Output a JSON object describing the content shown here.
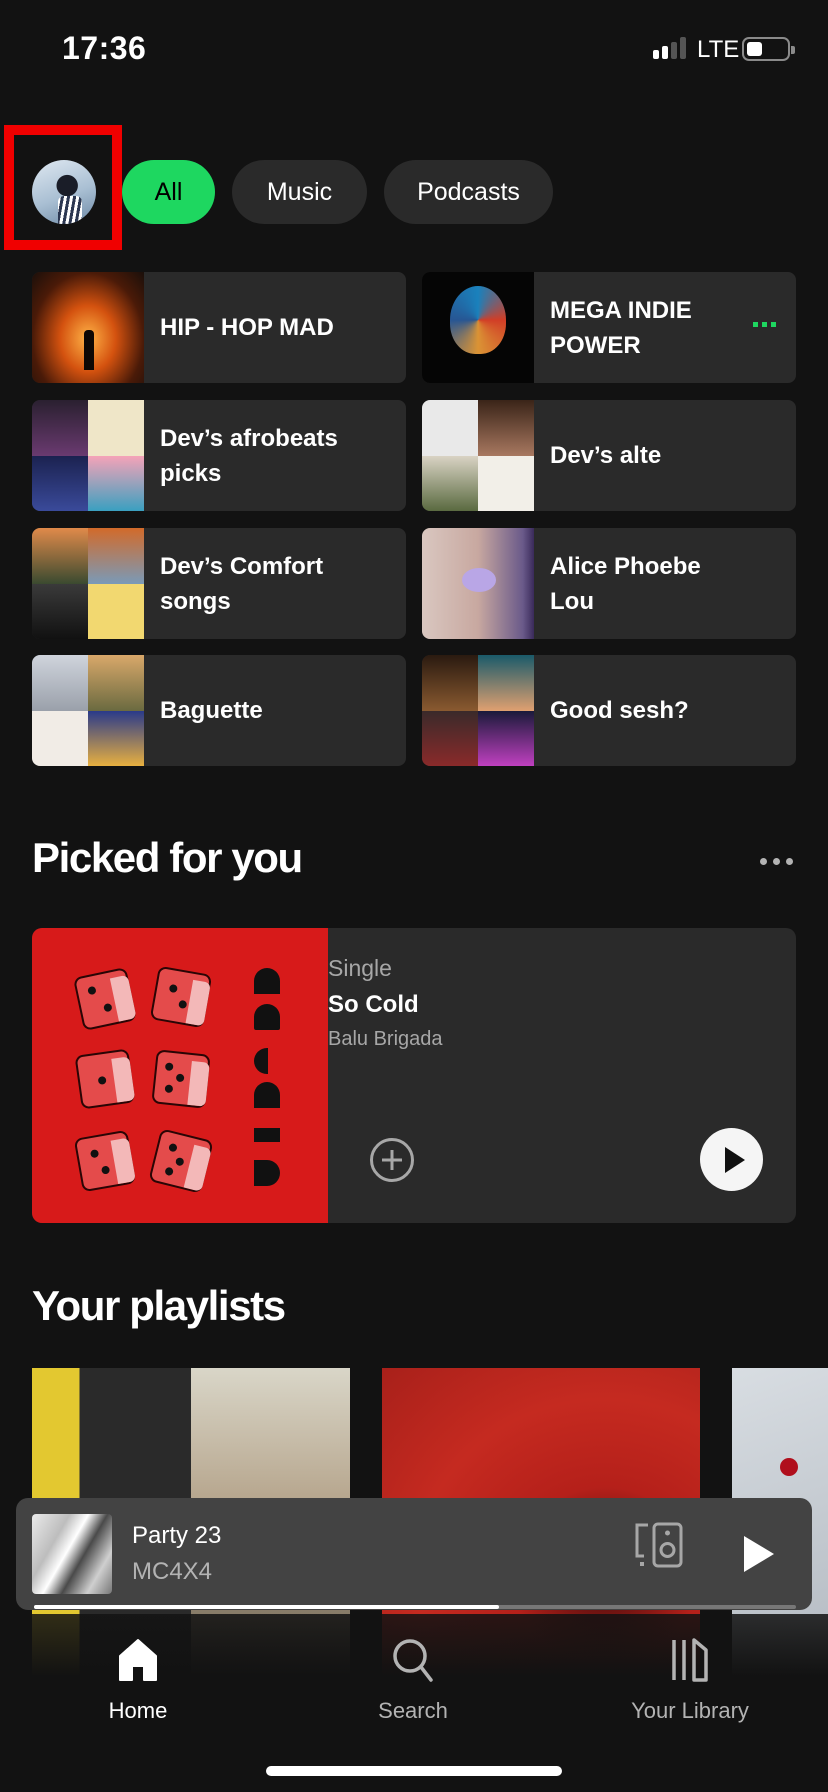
{
  "status_bar": {
    "time": "17:36",
    "network": "LTE",
    "signal_bars": 2,
    "signal_bars_total": 4,
    "battery_percent": 40
  },
  "header": {
    "avatar_icon": "profile-avatar",
    "filters": [
      {
        "label": "All",
        "active": true
      },
      {
        "label": "Music",
        "active": false
      },
      {
        "label": "Podcasts",
        "active": false
      }
    ]
  },
  "quick_access": [
    {
      "title": "HIP - HOP MAD",
      "playing": false
    },
    {
      "title": "MEGA INDIE POWER",
      "playing": true
    },
    {
      "title": "Dev’s afrobeats picks",
      "playing": false
    },
    {
      "title": "Dev’s alte",
      "playing": false
    },
    {
      "title": "Dev’s Comfort songs",
      "playing": false
    },
    {
      "title": "Alice Phoebe Lou",
      "playing": false
    },
    {
      "title": "Baguette",
      "playing": false
    },
    {
      "title": "Good sesh?",
      "playing": false
    }
  ],
  "picked_for_you": {
    "heading": "Picked for you",
    "more_icon": "more-horizontal-icon",
    "card": {
      "type": "Single",
      "title": "So Cold",
      "artist": "Balu Brigada",
      "add_icon": "add-circle-icon",
      "play_icon": "play-icon"
    }
  },
  "your_playlists": {
    "heading": "Your playlists",
    "tile_count": 3
  },
  "mini_player": {
    "title": "Party 23",
    "artist": "MC4X4",
    "progress": 0.61,
    "devices_icon": "connect-devices-icon",
    "play_icon": "play-icon"
  },
  "bottom_nav": [
    {
      "label": "Home",
      "icon": "home-icon",
      "active": true
    },
    {
      "label": "Search",
      "icon": "search-icon",
      "active": false
    },
    {
      "label": "Your Library",
      "icon": "library-icon",
      "active": false
    }
  ],
  "colors": {
    "accent": "#1ed760",
    "background": "#121212",
    "card": "#2a2a2a",
    "mini_player": "#434343",
    "highlight_box": "#f00000"
  }
}
